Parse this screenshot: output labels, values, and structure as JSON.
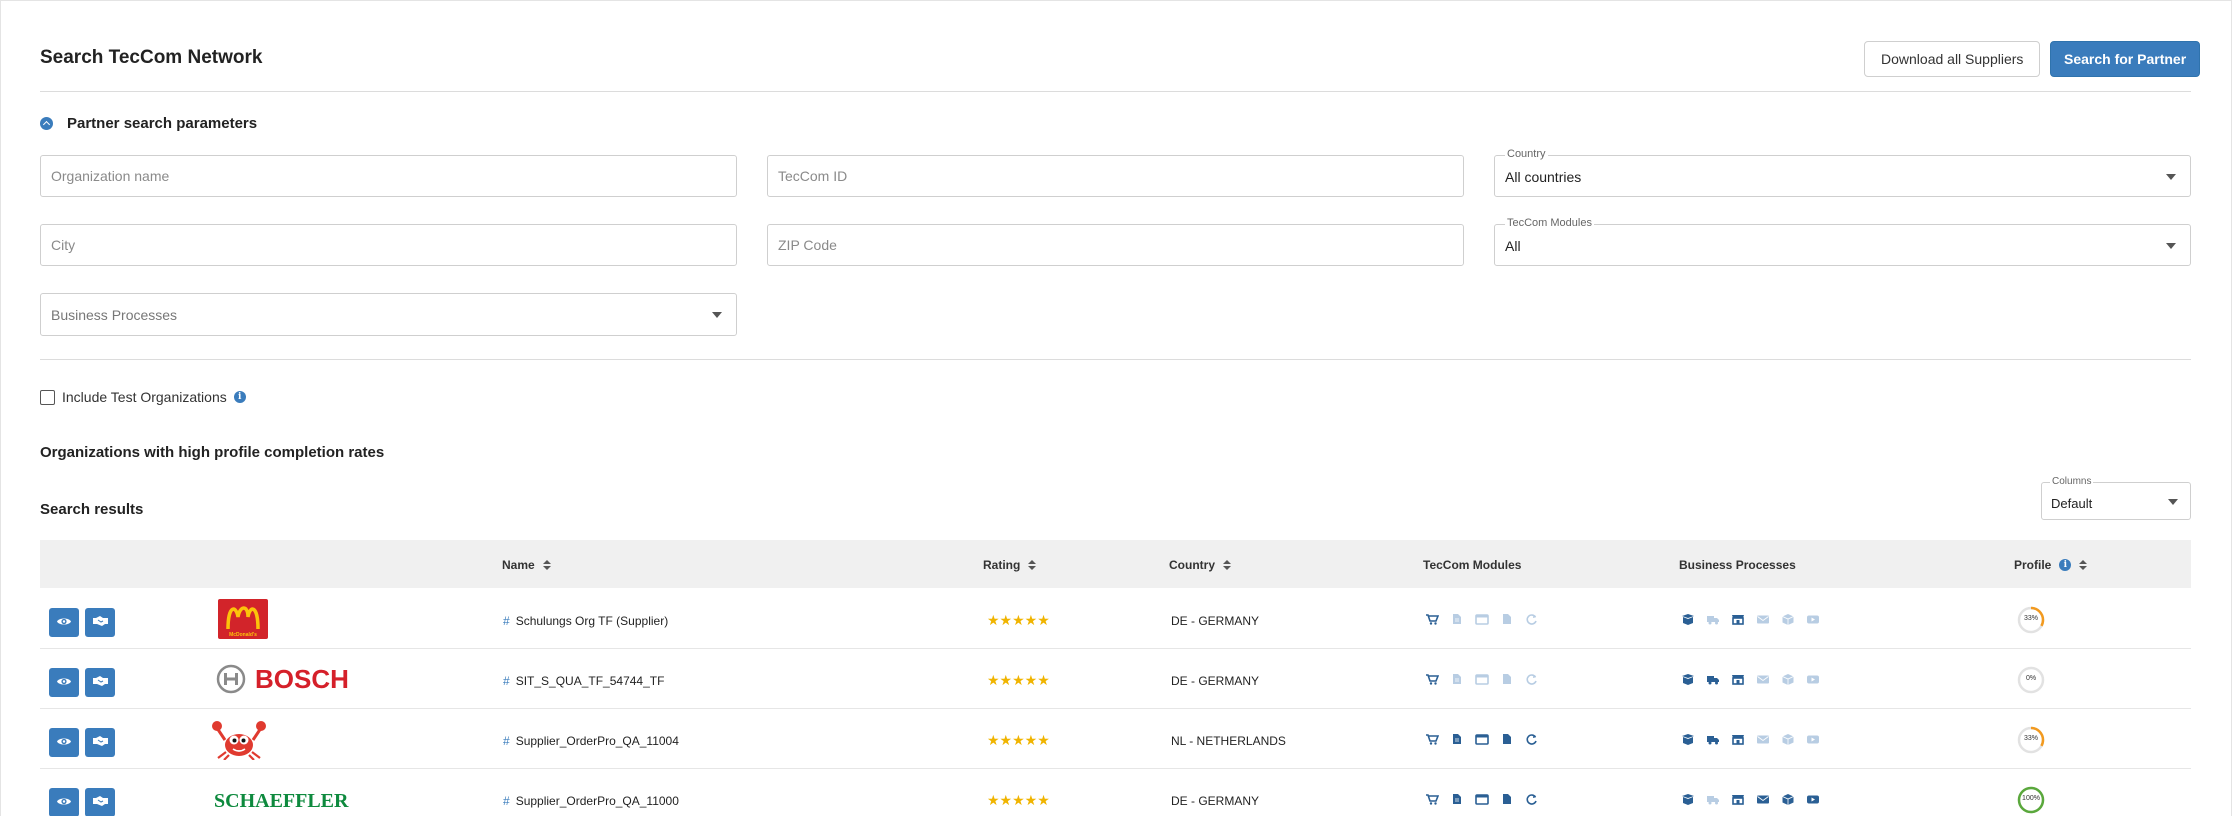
{
  "header": {
    "title": "Search TecCom Network",
    "download_label": "Download all Suppliers",
    "search_label": "Search for Partner"
  },
  "params": {
    "section_label": "Partner search parameters",
    "organization_placeholder": "Organization name",
    "teccom_id_placeholder": "TecCom ID",
    "country_label": "Country",
    "country_value": "All countries",
    "city_placeholder": "City",
    "zip_placeholder": "ZIP Code",
    "modules_label": "TecCom Modules",
    "modules_value": "All",
    "business_processes_placeholder": "Business Processes",
    "include_test_label": "Include Test Organizations"
  },
  "results": {
    "high_completion_heading": "Organizations with high profile completion rates",
    "search_results_heading": "Search results",
    "columns_label": "Columns",
    "columns_value": "Default",
    "headers": {
      "name": "Name",
      "rating": "Rating",
      "country": "Country",
      "modules": "TecCom Modules",
      "processes": "Business Processes",
      "profile": "Profile"
    },
    "rows": [
      {
        "name": "Schulungs Org TF (Supplier)",
        "stars": "★★★★★",
        "country": "DE - GERMANY",
        "logo": "mcdonalds-logo",
        "logo_text": "McDonald's",
        "profile": "33%",
        "profile_value": 0.33,
        "profile_color": "#f29a1f",
        "modules_active": [
          true,
          false,
          false,
          false,
          false
        ],
        "processes_active": [
          true,
          false,
          true,
          false,
          false,
          false
        ]
      },
      {
        "name": "SIT_S_QUA_TF_54744_TF",
        "stars": "★★★★★",
        "country": "DE - GERMANY",
        "logo": "bosch-logo",
        "logo_text": "BOSCH",
        "profile": "0%",
        "profile_value": 0,
        "profile_color": "#cfcfcf",
        "modules_active": [
          true,
          false,
          false,
          false,
          false
        ],
        "processes_active": [
          true,
          true,
          true,
          false,
          false,
          false
        ]
      },
      {
        "name": "Supplier_OrderPro_QA_11004",
        "stars": "★★★★★",
        "country": "NL - NETHERLANDS",
        "logo": "crab-logo",
        "logo_text": "",
        "profile": "33%",
        "profile_value": 0.33,
        "profile_color": "#f29a1f",
        "modules_active": [
          true,
          true,
          true,
          true,
          true
        ],
        "processes_active": [
          true,
          true,
          true,
          false,
          false,
          false
        ]
      },
      {
        "name": "Supplier_OrderPro_QA_11000",
        "stars": "★★★★★",
        "country": "DE - GERMANY",
        "logo": "schaeffler-logo",
        "logo_text": "SCHAEFFLER",
        "profile": "100%",
        "profile_value": 1,
        "profile_color": "#5aa83c",
        "modules_active": [
          true,
          true,
          true,
          true,
          true
        ],
        "processes_active": [
          true,
          false,
          true,
          true,
          true,
          true
        ]
      }
    ]
  },
  "colors": {
    "primary": "#3a7cbc",
    "star": "#f0b400",
    "active_icon": "#2a5f94",
    "inactive_icon": "#b8cde3"
  }
}
